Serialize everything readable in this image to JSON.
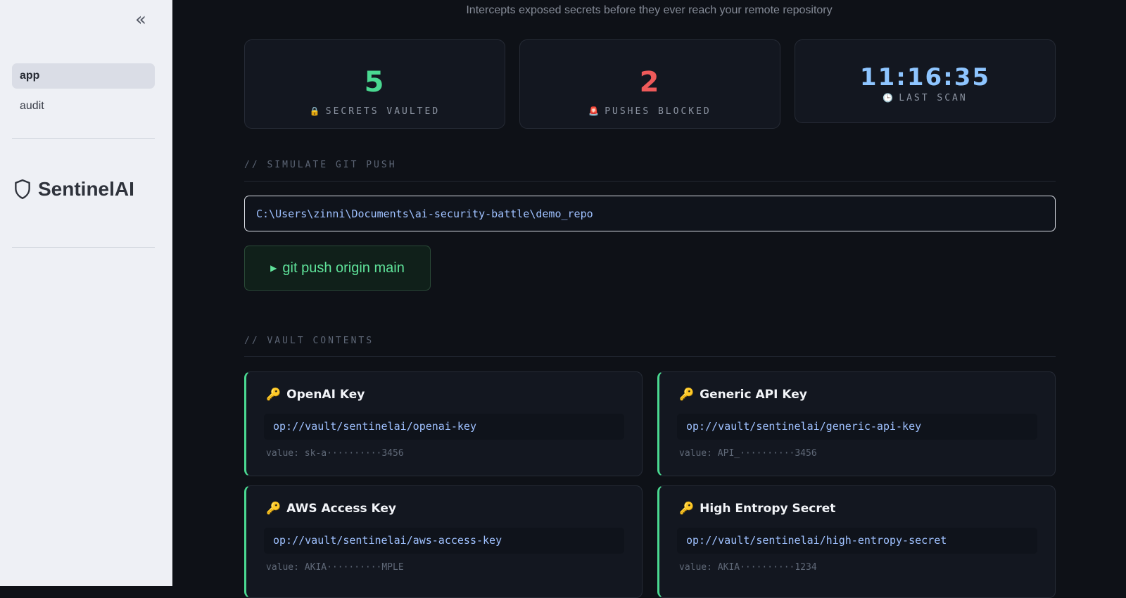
{
  "sidebar": {
    "collapse_label": "«",
    "nav": [
      {
        "label": "app",
        "active": true
      },
      {
        "label": "audit",
        "active": false
      }
    ],
    "brand": {
      "icon": "shield-icon",
      "name": "SentinelAI"
    }
  },
  "header": {
    "subtitle": "Intercepts exposed secrets before they ever reach your remote repository"
  },
  "stats": [
    {
      "value": "5",
      "icon": "🔒",
      "label": "SECRETS VAULTED",
      "color": "#4ad991"
    },
    {
      "value": "2",
      "icon": "🚨",
      "label": "PUSHES BLOCKED",
      "color": "#ef5a5a"
    },
    {
      "value": "11:16:35",
      "icon": "🕒",
      "label": "LAST SCAN",
      "color": "#8ec5ff"
    }
  ],
  "push_section": {
    "title": "// SIMULATE GIT PUSH",
    "repo_path": "C:\\Users\\zinni\\Documents\\ai-security-battle\\demo_repo",
    "button_icon": "▶",
    "button_label": "git push origin main"
  },
  "vault_section": {
    "title": "// VAULT CONTENTS",
    "items": [
      {
        "icon": "🔑",
        "name": "OpenAI Key",
        "ref": "op://vault/sentinelai/openai-key",
        "value": "value: sk-a··········3456"
      },
      {
        "icon": "🔑",
        "name": "Generic API Key",
        "ref": "op://vault/sentinelai/generic-api-key",
        "value": "value: API_··········3456"
      },
      {
        "icon": "🔑",
        "name": "AWS Access Key",
        "ref": "op://vault/sentinelai/aws-access-key",
        "value": "value: AKIA··········MPLE"
      },
      {
        "icon": "🔑",
        "name": "High Entropy Secret",
        "ref": "op://vault/sentinelai/high-entropy-secret",
        "value": "value: AKIA··········1234"
      }
    ]
  },
  "colors": {
    "accent_green": "#4ad991",
    "accent_red": "#ef5a5a",
    "accent_blue": "#8ec5ff"
  }
}
